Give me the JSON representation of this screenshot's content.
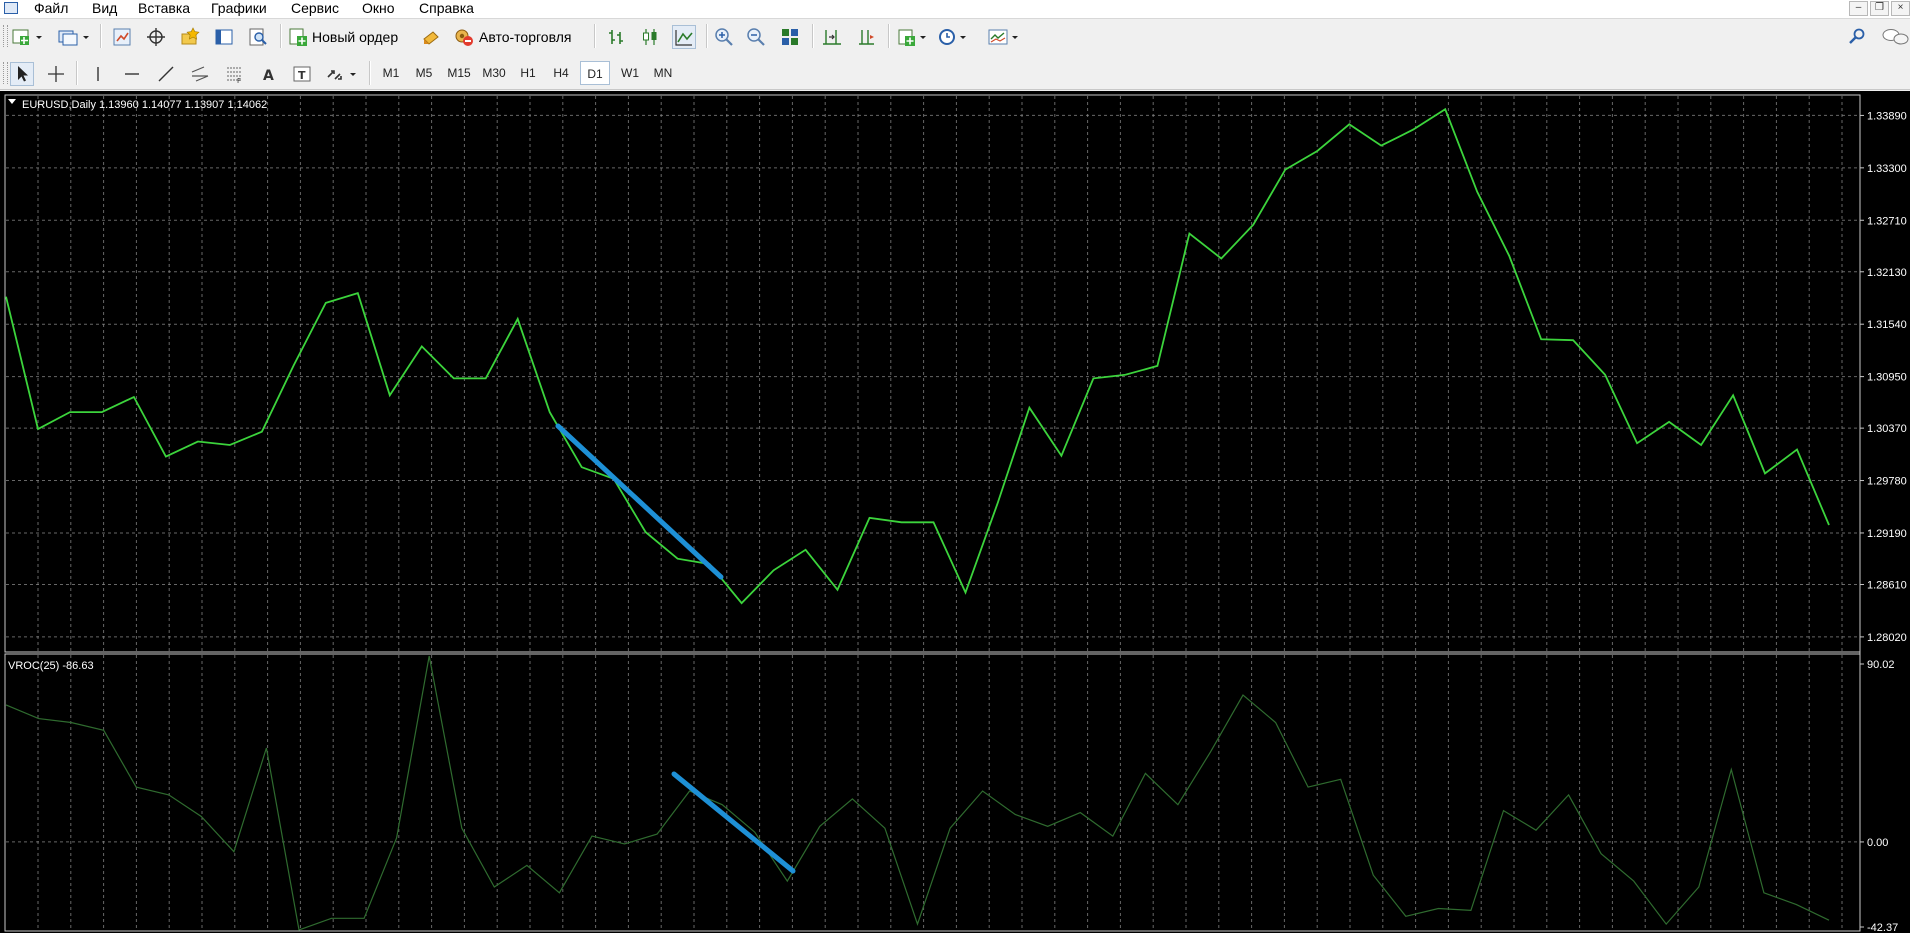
{
  "menu": {
    "items": [
      "Файл",
      "Вид",
      "Вставка",
      "Графики",
      "Сервис",
      "Окно",
      "Справка"
    ]
  },
  "toolbar": {
    "new_order_label": "Новый ордер",
    "auto_trading_label": "Авто-торговля"
  },
  "timeframes": [
    "M1",
    "M5",
    "M15",
    "M30",
    "H1",
    "H4",
    "D1",
    "W1",
    "MN"
  ],
  "active_timeframe": "D1",
  "colors": {
    "price_line": "#3cd43c",
    "indicator_line": "#2f6b2f",
    "annotation": "#1e90d6",
    "grid": "#8a8a8a",
    "background": "#000000"
  },
  "price_chart": {
    "header": "EURUSD,Daily  1.13960 1.14077 1.13907 1.14062",
    "y_ticks": [
      "1.33890",
      "1.33300",
      "1.32710",
      "1.32130",
      "1.31540",
      "1.30950",
      "1.30370",
      "1.29780",
      "1.29190",
      "1.28610",
      "1.28020"
    ]
  },
  "indicator_chart": {
    "header": "VROC(25) -86.63",
    "y_ticks": [
      "90.02",
      "0.00",
      "-42.37"
    ]
  },
  "chart_data": [
    {
      "type": "line",
      "series": [
        {
          "values": [
            1.3185,
            1.3036,
            1.3055,
            1.3055,
            1.3072,
            1.3005,
            1.3022,
            1.3018,
            1.3033,
            1.3108,
            1.3178,
            1.3189,
            1.3074,
            1.3129,
            1.3093,
            1.3093,
            1.316,
            1.3055,
            1.2993,
            1.298,
            1.292,
            1.289,
            1.2884,
            1.284,
            1.2877,
            1.29,
            1.2855,
            1.2936,
            1.2931,
            1.2931,
            1.2852,
            1.2952,
            1.306,
            1.3006,
            1.3093,
            1.3097,
            1.3107,
            1.3256,
            1.3228,
            1.3266,
            1.3328,
            1.3349,
            1.3379,
            1.3355,
            1.3373,
            1.3396,
            1.3303,
            1.3231,
            1.3137,
            1.3136,
            1.3097,
            1.302,
            1.3044,
            1.3018,
            1.3074,
            1.2986,
            1.3013,
            1.2928
          ]
        }
      ],
      "ylim": [
        1.2785,
        1.3412
      ]
    },
    {
      "type": "line",
      "series": [
        {
          "values": [
            70,
            63,
            61,
            57,
            28,
            24,
            13,
            -5,
            48,
            -45,
            -39,
            -39,
            2,
            95,
            7,
            -23,
            -12,
            -26,
            3,
            -1,
            4,
            26,
            19,
            5,
            -20,
            8,
            22,
            7,
            -42,
            7,
            26,
            14,
            8,
            15,
            3,
            35,
            19,
            46,
            75,
            61,
            28,
            32,
            -17,
            -38,
            -34,
            -35,
            16,
            6,
            24,
            -6,
            -20,
            -42,
            -23,
            37,
            -26,
            -32,
            -40
          ]
        }
      ],
      "ylim": [
        -45.5,
        96
      ]
    }
  ]
}
